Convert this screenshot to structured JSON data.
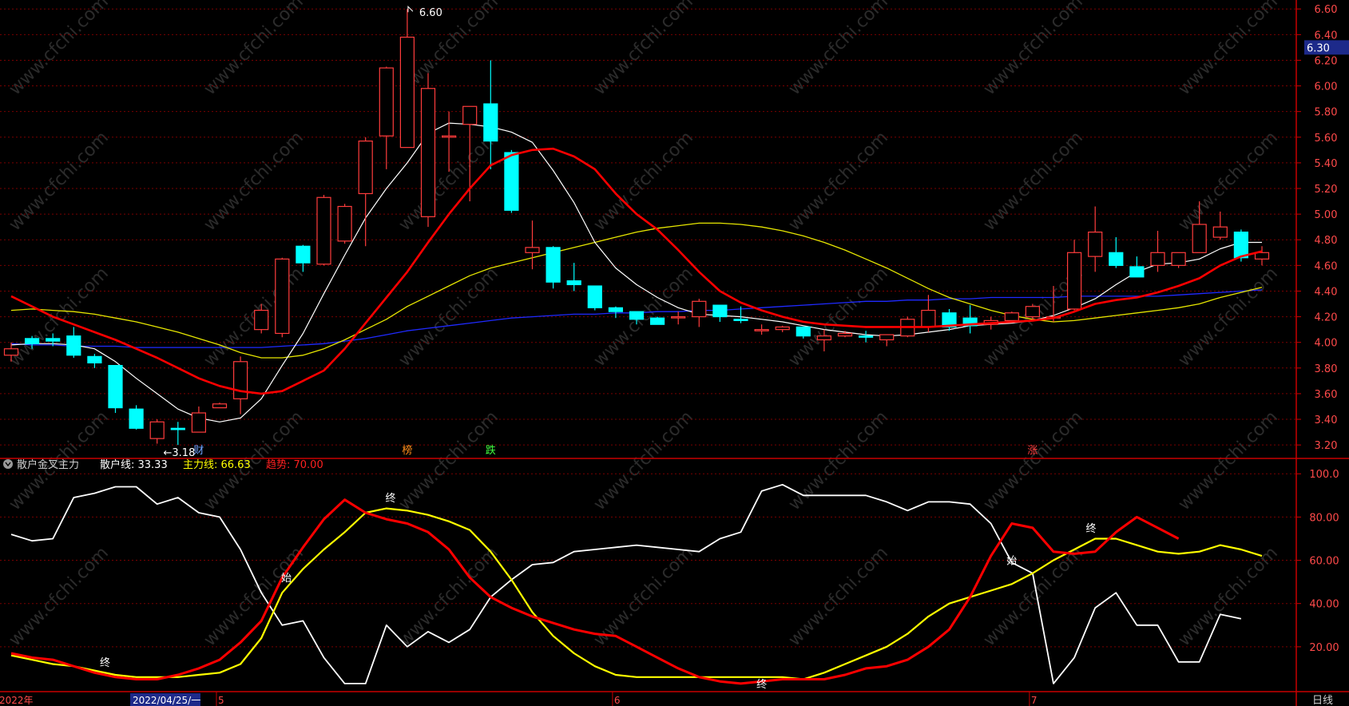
{
  "colors": {
    "up": "#ff3c3c",
    "down": "#00ffff",
    "ma5": "#ffffff",
    "ma10": "#ff0000",
    "ma20": "#e6e600",
    "ma60": "#1f2aff",
    "grid": "#7a0000",
    "axis": "#c80000",
    "white_line": "#ffffff",
    "yellow_line": "#ffff00",
    "red_line": "#ff0000"
  },
  "price_panel": {
    "ylim": [
      3.12,
      6.62
    ],
    "ticks": [
      "6.60",
      "6.40",
      "6.20",
      "6.00",
      "5.80",
      "5.60",
      "5.40",
      "5.20",
      "5.00",
      "4.80",
      "4.60",
      "4.40",
      "4.20",
      "4.00",
      "3.80",
      "3.60",
      "3.40",
      "3.20"
    ],
    "current_price_label": "6.30",
    "current_price_value": 6.3,
    "high_marker": "6.60",
    "low_marker": "3.18",
    "event_tags": [
      {
        "i": 9,
        "text": "财",
        "color": "#6fa3ff"
      },
      {
        "i": 19,
        "text": "榜",
        "color": "#ff8c1a"
      },
      {
        "i": 23,
        "text": "跌",
        "color": "#40ff40"
      },
      {
        "i": 49,
        "text": "涨",
        "color": "#ff4040"
      }
    ]
  },
  "indicator_panel": {
    "name": "散户金叉主力",
    "labels": [
      {
        "name": "散户线:",
        "value": "33.33",
        "color": "#ffffff"
      },
      {
        "name": "主力线:",
        "value": "66.63",
        "color": "#ffff00"
      },
      {
        "name": "趋势:",
        "value": "70.00",
        "color": "#ff2020"
      }
    ],
    "ticks": [
      "100.0",
      "80.00",
      "60.00",
      "40.00",
      "20.00"
    ],
    "ylim": [
      0,
      106
    ],
    "signals": [
      {
        "x": 4.5,
        "y": 13,
        "text": "终"
      },
      {
        "x": 13.2,
        "y": 52,
        "text": "始"
      },
      {
        "x": 18.2,
        "y": 89,
        "text": "终"
      },
      {
        "x": 36.0,
        "y": 3,
        "text": "终"
      },
      {
        "x": 48.0,
        "y": 60,
        "text": "始"
      },
      {
        "x": 51.8,
        "y": 75,
        "text": "终"
      }
    ]
  },
  "date_axis": {
    "labels": [
      {
        "i": -0.5,
        "text": "2022年",
        "selected": false
      },
      {
        "i": 5.9,
        "text": "2022/04/25/一",
        "selected": true
      },
      {
        "i": 10,
        "text": "5",
        "selected": false
      },
      {
        "i": 29,
        "text": "6",
        "selected": false
      },
      {
        "i": 49,
        "text": "7",
        "selected": false
      }
    ]
  },
  "period_label": "日线",
  "watermark": "www.cfchi.com",
  "chart_data": {
    "type": "candlestick",
    "title": "",
    "ylim": [
      3.12,
      6.62
    ],
    "series": [
      {
        "name": "K线",
        "ohlc": [
          [
            3.9,
            4.0,
            3.85,
            3.95
          ],
          [
            4.03,
            4.05,
            3.95,
            3.99
          ],
          [
            4.03,
            4.07,
            3.97,
            4.01
          ],
          [
            4.05,
            4.12,
            3.88,
            3.9
          ],
          [
            3.89,
            3.91,
            3.8,
            3.84
          ],
          [
            3.82,
            3.82,
            3.45,
            3.49
          ],
          [
            3.48,
            3.51,
            3.32,
            3.33
          ],
          [
            3.25,
            3.4,
            3.21,
            3.38
          ],
          [
            3.33,
            3.38,
            3.2,
            3.32
          ],
          [
            3.3,
            3.5,
            3.3,
            3.45
          ],
          [
            3.49,
            3.53,
            3.49,
            3.52
          ],
          [
            3.56,
            3.89,
            3.44,
            3.85
          ],
          [
            4.1,
            4.3,
            4.07,
            4.25
          ],
          [
            4.07,
            4.66,
            4.04,
            4.65
          ],
          [
            4.75,
            4.76,
            4.55,
            4.62
          ],
          [
            4.61,
            5.15,
            4.6,
            5.13
          ],
          [
            4.79,
            5.08,
            4.77,
            5.06
          ],
          [
            5.16,
            5.6,
            4.75,
            5.57
          ],
          [
            5.61,
            6.15,
            5.35,
            6.14
          ],
          [
            5.52,
            6.6,
            5.52,
            6.38
          ],
          [
            4.98,
            6.1,
            4.9,
            5.98
          ],
          [
            5.6,
            5.8,
            5.33,
            5.61
          ],
          [
            5.7,
            5.83,
            5.1,
            5.84
          ],
          [
            5.86,
            6.2,
            5.35,
            5.57
          ],
          [
            5.48,
            5.5,
            5.01,
            5.03
          ],
          [
            4.7,
            4.95,
            4.57,
            4.74
          ],
          [
            4.74,
            4.75,
            4.42,
            4.47
          ],
          [
            4.48,
            4.62,
            4.4,
            4.45
          ],
          [
            4.44,
            4.44,
            4.25,
            4.27
          ],
          [
            4.27,
            4.28,
            4.19,
            4.24
          ],
          [
            4.24,
            4.24,
            4.14,
            4.18
          ],
          [
            4.19,
            4.2,
            4.14,
            4.14
          ],
          [
            4.2,
            4.24,
            4.14,
            4.2
          ],
          [
            4.2,
            4.34,
            4.12,
            4.32
          ],
          [
            4.29,
            4.29,
            4.16,
            4.2
          ],
          [
            4.18,
            4.28,
            4.15,
            4.17
          ],
          [
            4.09,
            4.14,
            4.06,
            4.1
          ],
          [
            4.1,
            4.13,
            4.08,
            4.12
          ],
          [
            4.12,
            4.12,
            4.03,
            4.05
          ],
          [
            4.02,
            4.1,
            3.93,
            4.05
          ],
          [
            4.05,
            4.09,
            4.04,
            4.07
          ],
          [
            4.05,
            4.09,
            4.0,
            4.04
          ],
          [
            4.02,
            4.06,
            3.97,
            4.06
          ],
          [
            4.05,
            4.2,
            4.04,
            4.18
          ],
          [
            4.12,
            4.37,
            4.08,
            4.25
          ],
          [
            4.23,
            4.26,
            4.09,
            4.12
          ],
          [
            4.19,
            4.29,
            4.07,
            4.13
          ],
          [
            4.14,
            4.2,
            4.1,
            4.17
          ],
          [
            4.17,
            4.24,
            4.16,
            4.23
          ],
          [
            4.2,
            4.3,
            4.18,
            4.28
          ],
          [
            4.19,
            4.44,
            4.16,
            4.2
          ],
          [
            4.26,
            4.8,
            4.25,
            4.7
          ],
          [
            4.67,
            5.06,
            4.55,
            4.86
          ],
          [
            4.7,
            4.82,
            4.58,
            4.6
          ],
          [
            4.59,
            4.67,
            4.52,
            4.51
          ],
          [
            4.6,
            4.87,
            4.55,
            4.7
          ],
          [
            4.6,
            4.7,
            4.58,
            4.7
          ],
          [
            4.7,
            5.1,
            4.7,
            4.92
          ],
          [
            4.82,
            5.02,
            4.8,
            4.9
          ],
          [
            4.86,
            4.88,
            4.63,
            4.66
          ],
          [
            4.65,
            4.75,
            4.6,
            4.7
          ]
        ]
      },
      {
        "name": "MA5",
        "values": [
          3.98,
          3.99,
          3.99,
          3.98,
          3.95,
          3.85,
          3.72,
          3.6,
          3.48,
          3.41,
          3.38,
          3.41,
          3.56,
          3.82,
          4.07,
          4.38,
          4.68,
          4.97,
          5.2,
          5.4,
          5.63,
          5.71,
          5.7,
          5.68,
          5.64,
          5.56,
          5.34,
          5.09,
          4.78,
          4.58,
          4.45,
          4.35,
          4.27,
          4.22,
          4.21,
          4.2,
          4.18,
          4.16,
          4.13,
          4.1,
          4.08,
          4.06,
          4.05,
          4.06,
          4.08,
          4.1,
          4.13,
          4.14,
          4.15,
          4.17,
          4.21,
          4.27,
          4.34,
          4.45,
          4.55,
          4.61,
          4.62,
          4.65,
          4.73,
          4.78,
          4.78
        ]
      },
      {
        "name": "MA10",
        "values": [
          4.36,
          4.28,
          4.2,
          4.14,
          4.08,
          4.02,
          3.95,
          3.88,
          3.8,
          3.72,
          3.66,
          3.62,
          3.6,
          3.62,
          3.7,
          3.78,
          3.95,
          4.15,
          4.35,
          4.55,
          4.78,
          5.0,
          5.2,
          5.38,
          5.46,
          5.5,
          5.51,
          5.45,
          5.35,
          5.16,
          5.0,
          4.88,
          4.72,
          4.55,
          4.4,
          4.31,
          4.25,
          4.2,
          4.16,
          4.14,
          4.13,
          4.12,
          4.12,
          4.12,
          4.12,
          4.13,
          4.14,
          4.15,
          4.16,
          4.17,
          4.19,
          4.24,
          4.3,
          4.33,
          4.35,
          4.39,
          4.44,
          4.5,
          4.6,
          4.67,
          4.71
        ]
      },
      {
        "name": "MA20",
        "values": [
          4.25,
          4.26,
          4.25,
          4.24,
          4.22,
          4.19,
          4.16,
          4.12,
          4.08,
          4.03,
          3.98,
          3.92,
          3.88,
          3.88,
          3.9,
          3.95,
          4.02,
          4.1,
          4.18,
          4.28,
          4.36,
          4.44,
          4.52,
          4.58,
          4.62,
          4.66,
          4.7,
          4.74,
          4.78,
          4.82,
          4.86,
          4.89,
          4.91,
          4.93,
          4.93,
          4.92,
          4.9,
          4.87,
          4.83,
          4.78,
          4.72,
          4.65,
          4.58,
          4.5,
          4.42,
          4.35,
          4.3,
          4.25,
          4.21,
          4.18,
          4.16,
          4.17,
          4.19,
          4.21,
          4.23,
          4.25,
          4.27,
          4.3,
          4.35,
          4.39,
          4.43
        ]
      },
      {
        "name": "MA60",
        "values": [
          3.99,
          3.98,
          3.98,
          3.97,
          3.97,
          3.97,
          3.96,
          3.96,
          3.96,
          3.96,
          3.96,
          3.96,
          3.96,
          3.97,
          3.98,
          3.99,
          4.01,
          4.03,
          4.06,
          4.09,
          4.11,
          4.13,
          4.15,
          4.17,
          4.19,
          4.2,
          4.21,
          4.22,
          4.22,
          4.23,
          4.23,
          4.24,
          4.24,
          4.25,
          4.25,
          4.26,
          4.27,
          4.28,
          4.29,
          4.3,
          4.31,
          4.32,
          4.32,
          4.33,
          4.33,
          4.34,
          4.34,
          4.35,
          4.35,
          4.35,
          4.35,
          4.36,
          4.36,
          4.36,
          4.36,
          4.36,
          4.37,
          4.38,
          4.39,
          4.4,
          4.41
        ]
      },
      {
        "name": "散户线",
        "values": [
          72,
          69,
          70,
          89,
          91,
          94,
          94,
          86,
          89,
          82,
          80,
          65,
          45,
          30,
          32,
          15,
          3,
          3,
          30,
          20,
          27,
          22,
          28,
          43,
          51,
          58,
          59,
          64,
          65,
          66,
          67,
          66,
          65,
          64,
          70,
          73,
          92,
          95,
          90,
          90,
          90,
          90,
          87,
          83,
          87,
          87,
          86,
          77,
          59,
          54,
          3,
          15,
          38,
          45,
          30,
          30,
          13,
          13,
          35,
          33
        ]
      },
      {
        "name": "主力线",
        "values": [
          16,
          14,
          12,
          11,
          9,
          7,
          6,
          6,
          6,
          7,
          8,
          12,
          24,
          45,
          56,
          65,
          73,
          82,
          84,
          83,
          81,
          78,
          74,
          64,
          51,
          36,
          25,
          17,
          11,
          7,
          6,
          6,
          6,
          6,
          6,
          6,
          6,
          6,
          5,
          8,
          12,
          16,
          20,
          26,
          34,
          40,
          43,
          46,
          49,
          54,
          60,
          65,
          70,
          70,
          67,
          64,
          63,
          64,
          67,
          65,
          62
        ]
      },
      {
        "name": "趋势",
        "values": [
          17,
          15,
          14,
          11,
          8,
          6,
          5,
          5,
          7,
          10,
          14,
          22,
          32,
          52,
          66,
          79,
          88,
          82,
          79,
          77,
          73,
          65,
          52,
          43,
          38,
          34,
          31,
          28,
          26,
          25,
          20,
          15,
          10,
          6,
          4,
          3,
          4,
          5,
          5,
          5,
          7,
          10,
          11,
          14,
          20,
          28,
          43,
          62,
          77,
          75,
          64,
          63,
          64,
          73,
          80,
          75,
          70
        ]
      }
    ]
  }
}
